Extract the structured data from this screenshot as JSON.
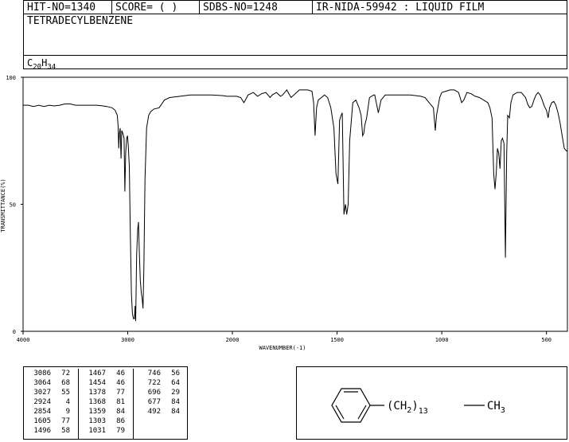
{
  "header": {
    "hit_no": "HIT-NO=1340",
    "score": "SCORE=  (  )",
    "sdbs_no": "SDBS-NO=1248",
    "method": "IR-NIDA-59942 : LIQUID FILM",
    "compound_name": "TETRADECYLBENZENE",
    "formula_main": "C",
    "formula_c_count": "20",
    "formula_h": "H",
    "formula_h_count": "34"
  },
  "chart_data": {
    "type": "line",
    "title": "",
    "xlabel": "WAVENUMBER(-1)",
    "ylabel": "TRANSMITTANCE(%)",
    "xlim": [
      4000,
      400
    ],
    "ylim": [
      0,
      100
    ],
    "x_ticks": [
      4000,
      3000,
      2000,
      1500,
      1000,
      500
    ],
    "y_ticks": [
      0,
      50,
      100
    ],
    "grid": false,
    "series": [
      {
        "name": "",
        "points": [
          [
            4000,
            89
          ],
          [
            3950,
            89
          ],
          [
            3900,
            88.5
          ],
          [
            3850,
            89
          ],
          [
            3800,
            88.5
          ],
          [
            3750,
            89
          ],
          [
            3700,
            88.7
          ],
          [
            3650,
            89
          ],
          [
            3600,
            89.5
          ],
          [
            3550,
            89.5
          ],
          [
            3500,
            89
          ],
          [
            3450,
            89
          ],
          [
            3400,
            89
          ],
          [
            3350,
            89
          ],
          [
            3300,
            89
          ],
          [
            3250,
            88.8
          ],
          [
            3200,
            88.5
          ],
          [
            3150,
            88
          ],
          [
            3120,
            87
          ],
          [
            3100,
            85
          ],
          [
            3092,
            81
          ],
          [
            3086,
            72
          ],
          [
            3080,
            78
          ],
          [
            3072,
            80
          ],
          [
            3064,
            68
          ],
          [
            3057,
            79
          ],
          [
            3047,
            78
          ],
          [
            3035,
            76
          ],
          [
            3027,
            55
          ],
          [
            3020,
            70
          ],
          [
            3010,
            76
          ],
          [
            3002,
            77
          ],
          [
            2995,
            73
          ],
          [
            2985,
            65
          ],
          [
            2975,
            38
          ],
          [
            2965,
            15
          ],
          [
            2955,
            7
          ],
          [
            2945,
            5
          ],
          [
            2935,
            5
          ],
          [
            2930,
            10
          ],
          [
            2924,
            4
          ],
          [
            2915,
            30
          ],
          [
            2905,
            40
          ],
          [
            2897,
            43
          ],
          [
            2890,
            32
          ],
          [
            2880,
            20
          ],
          [
            2870,
            15
          ],
          [
            2862,
            13
          ],
          [
            2854,
            9
          ],
          [
            2846,
            25
          ],
          [
            2835,
            60
          ],
          [
            2820,
            80
          ],
          [
            2800,
            85
          ],
          [
            2780,
            86.5
          ],
          [
            2750,
            87.5
          ],
          [
            2700,
            88
          ],
          [
            2650,
            91
          ],
          [
            2600,
            92
          ],
          [
            2500,
            92.5
          ],
          [
            2400,
            93
          ],
          [
            2300,
            93
          ],
          [
            2200,
            93
          ],
          [
            2100,
            92.8
          ],
          [
            2050,
            92.5
          ],
          [
            2000,
            92.5
          ],
          [
            1980,
            92.5
          ],
          [
            1960,
            92
          ],
          [
            1945,
            90
          ],
          [
            1938,
            91
          ],
          [
            1925,
            93
          ],
          [
            1900,
            94
          ],
          [
            1880,
            92.5
          ],
          [
            1860,
            93.5
          ],
          [
            1840,
            94
          ],
          [
            1820,
            92
          ],
          [
            1810,
            93
          ],
          [
            1790,
            94
          ],
          [
            1770,
            92.5
          ],
          [
            1760,
            93
          ],
          [
            1740,
            95
          ],
          [
            1720,
            92
          ],
          [
            1700,
            93.5
          ],
          [
            1680,
            95
          ],
          [
            1660,
            95
          ],
          [
            1640,
            95
          ],
          [
            1620,
            94.5
          ],
          [
            1612,
            90
          ],
          [
            1605,
            77
          ],
          [
            1598,
            88
          ],
          [
            1590,
            91
          ],
          [
            1575,
            92
          ],
          [
            1560,
            93
          ],
          [
            1545,
            92
          ],
          [
            1530,
            88
          ],
          [
            1515,
            80
          ],
          [
            1505,
            62
          ],
          [
            1496,
            58
          ],
          [
            1488,
            83
          ],
          [
            1481,
            85
          ],
          [
            1475,
            86
          ],
          [
            1467,
            46
          ],
          [
            1460,
            50
          ],
          [
            1454,
            46
          ],
          [
            1447,
            50
          ],
          [
            1440,
            75
          ],
          [
            1425,
            90
          ],
          [
            1410,
            91
          ],
          [
            1395,
            88
          ],
          [
            1385,
            85
          ],
          [
            1378,
            77
          ],
          [
            1372,
            78
          ],
          [
            1368,
            81
          ],
          [
            1359,
            84
          ],
          [
            1345,
            92
          ],
          [
            1325,
            93
          ],
          [
            1320,
            93
          ],
          [
            1303,
            86
          ],
          [
            1290,
            91
          ],
          [
            1270,
            93
          ],
          [
            1250,
            93
          ],
          [
            1200,
            93
          ],
          [
            1150,
            93
          ],
          [
            1100,
            92.5
          ],
          [
            1080,
            92
          ],
          [
            1060,
            90
          ],
          [
            1040,
            88
          ],
          [
            1031,
            79
          ],
          [
            1025,
            85
          ],
          [
            1010,
            92
          ],
          [
            1000,
            94
          ],
          [
            980,
            94.5
          ],
          [
            960,
            95
          ],
          [
            940,
            95
          ],
          [
            920,
            94
          ],
          [
            905,
            90
          ],
          [
            895,
            91
          ],
          [
            880,
            94
          ],
          [
            860,
            93.5
          ],
          [
            840,
            92.5
          ],
          [
            820,
            92
          ],
          [
            800,
            91
          ],
          [
            780,
            90
          ],
          [
            770,
            88
          ],
          [
            760,
            84
          ],
          [
            752,
            62
          ],
          [
            746,
            56
          ],
          [
            740,
            62
          ],
          [
            734,
            72
          ],
          [
            728,
            70
          ],
          [
            722,
            64
          ],
          [
            716,
            75
          ],
          [
            710,
            76
          ],
          [
            703,
            74
          ],
          [
            696,
            29
          ],
          [
            690,
            70
          ],
          [
            685,
            85
          ],
          [
            677,
            84
          ],
          [
            670,
            90
          ],
          [
            660,
            93
          ],
          [
            640,
            94
          ],
          [
            620,
            94
          ],
          [
            600,
            92
          ],
          [
            590,
            89.5
          ],
          [
            580,
            88
          ],
          [
            570,
            88.5
          ],
          [
            560,
            91
          ],
          [
            550,
            93
          ],
          [
            540,
            94
          ],
          [
            530,
            93
          ],
          [
            520,
            91
          ],
          [
            510,
            88.5
          ],
          [
            500,
            87
          ],
          [
            492,
            84
          ],
          [
            485,
            88
          ],
          [
            475,
            90
          ],
          [
            465,
            90.5
          ],
          [
            455,
            89
          ],
          [
            445,
            86
          ],
          [
            435,
            82
          ],
          [
            425,
            77
          ],
          [
            415,
            72
          ],
          [
            405,
            71
          ],
          [
            400,
            71
          ]
        ]
      }
    ]
  },
  "peak_table": {
    "columns": [
      [
        [
          "3086",
          "72"
        ],
        [
          "3064",
          "68"
        ],
        [
          "3027",
          "55"
        ],
        [
          "2924",
          "4"
        ],
        [
          "2854",
          "9"
        ],
        [
          "1605",
          "77"
        ],
        [
          "1496",
          "58"
        ]
      ],
      [
        [
          "1467",
          "46"
        ],
        [
          "1454",
          "46"
        ],
        [
          "1378",
          "77"
        ],
        [
          "1368",
          "81"
        ],
        [
          "1359",
          "84"
        ],
        [
          "1303",
          "86"
        ],
        [
          "1031",
          "79"
        ]
      ],
      [
        [
          "746",
          "56"
        ],
        [
          "722",
          "64"
        ],
        [
          "696",
          "29"
        ],
        [
          "677",
          "84"
        ],
        [
          "492",
          "84"
        ]
      ]
    ]
  },
  "structure": {
    "chain_open": "(CH",
    "chain_sub2": "2",
    "chain_close": ")",
    "repeat_count": "13",
    "terminal": "CH",
    "terminal_sub": "3"
  }
}
